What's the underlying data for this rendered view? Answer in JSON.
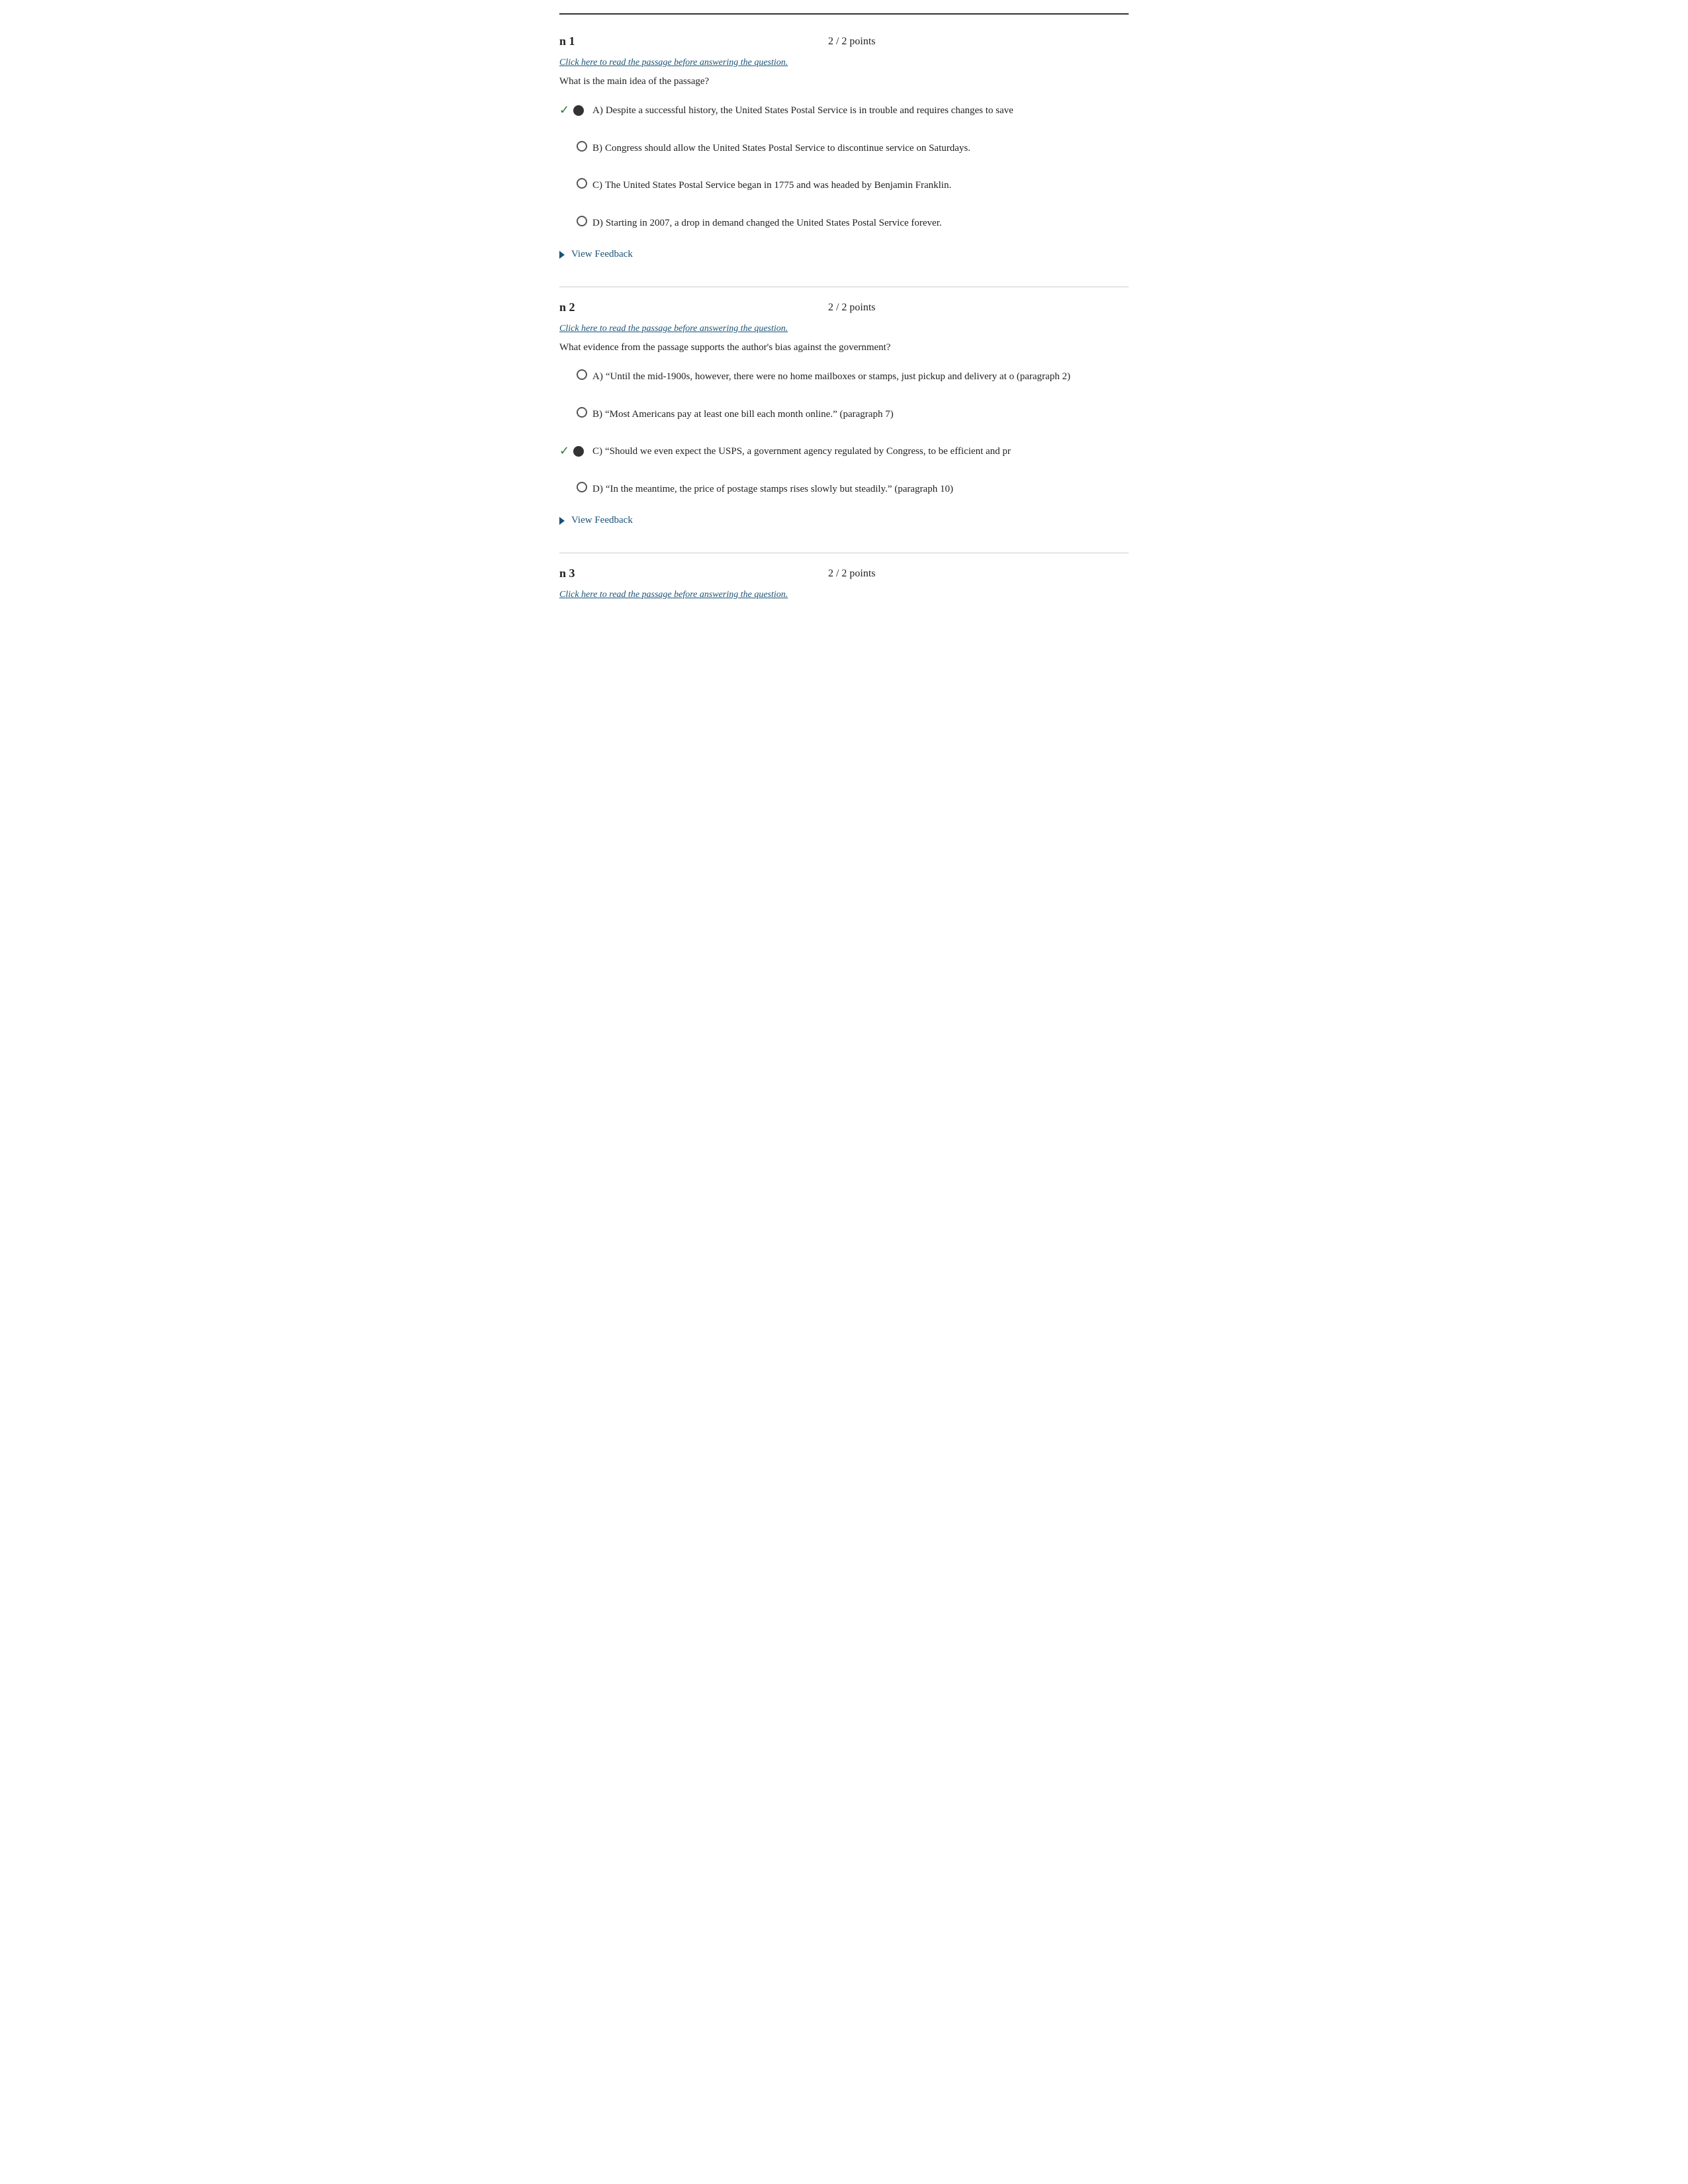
{
  "page": {
    "top_divider": true
  },
  "questions": [
    {
      "number": "n 1",
      "points": "2 / 2 points",
      "passage_link": "Click here to read the passage before answering the question.",
      "question_text": "What is the main idea of the passage?",
      "options": [
        {
          "id": "A",
          "label": "A)",
          "text": "Despite a successful history, the United States Postal Service is in trouble and requires changes to save",
          "correct": true,
          "selected": true
        },
        {
          "id": "B",
          "label": "B)",
          "text": "Congress should allow the United States Postal Service to discontinue service on Saturdays.",
          "correct": false,
          "selected": false
        },
        {
          "id": "C",
          "label": "C)",
          "text": "The United States Postal Service began in 1775 and was headed by Benjamin Franklin.",
          "correct": false,
          "selected": false
        },
        {
          "id": "D",
          "label": "D)",
          "text": "Starting in 2007, a drop in demand changed the United States Postal Service forever.",
          "correct": false,
          "selected": false
        }
      ],
      "view_feedback_label": "View Feedback"
    },
    {
      "number": "n 2",
      "points": "2 / 2 points",
      "passage_link": "Click here to read the passage before answering the question.",
      "question_text": "What evidence from the passage supports the author's bias against the government?",
      "options": [
        {
          "id": "A",
          "label": "A)",
          "text": "“Until the mid-1900s, however, there were no home mailboxes or stamps, just pickup and delivery at o (paragraph 2)",
          "correct": false,
          "selected": false
        },
        {
          "id": "B",
          "label": "B)",
          "text": "“Most Americans pay at least one bill each month online.” (paragraph 7)",
          "correct": false,
          "selected": false
        },
        {
          "id": "C",
          "label": "C)",
          "text": "“Should we even expect the USPS, a government agency regulated by Congress, to be efficient and pr",
          "correct": true,
          "selected": true
        },
        {
          "id": "D",
          "label": "D)",
          "text": "“In the meantime, the price of postage stamps rises slowly but steadily.” (paragraph 10)",
          "correct": false,
          "selected": false
        }
      ],
      "view_feedback_label": "View Feedback"
    },
    {
      "number": "n 3",
      "points": "2 / 2 points",
      "passage_link": "Click here to read the passage before answering the question.",
      "question_text": "",
      "options": [],
      "view_feedback_label": ""
    }
  ]
}
